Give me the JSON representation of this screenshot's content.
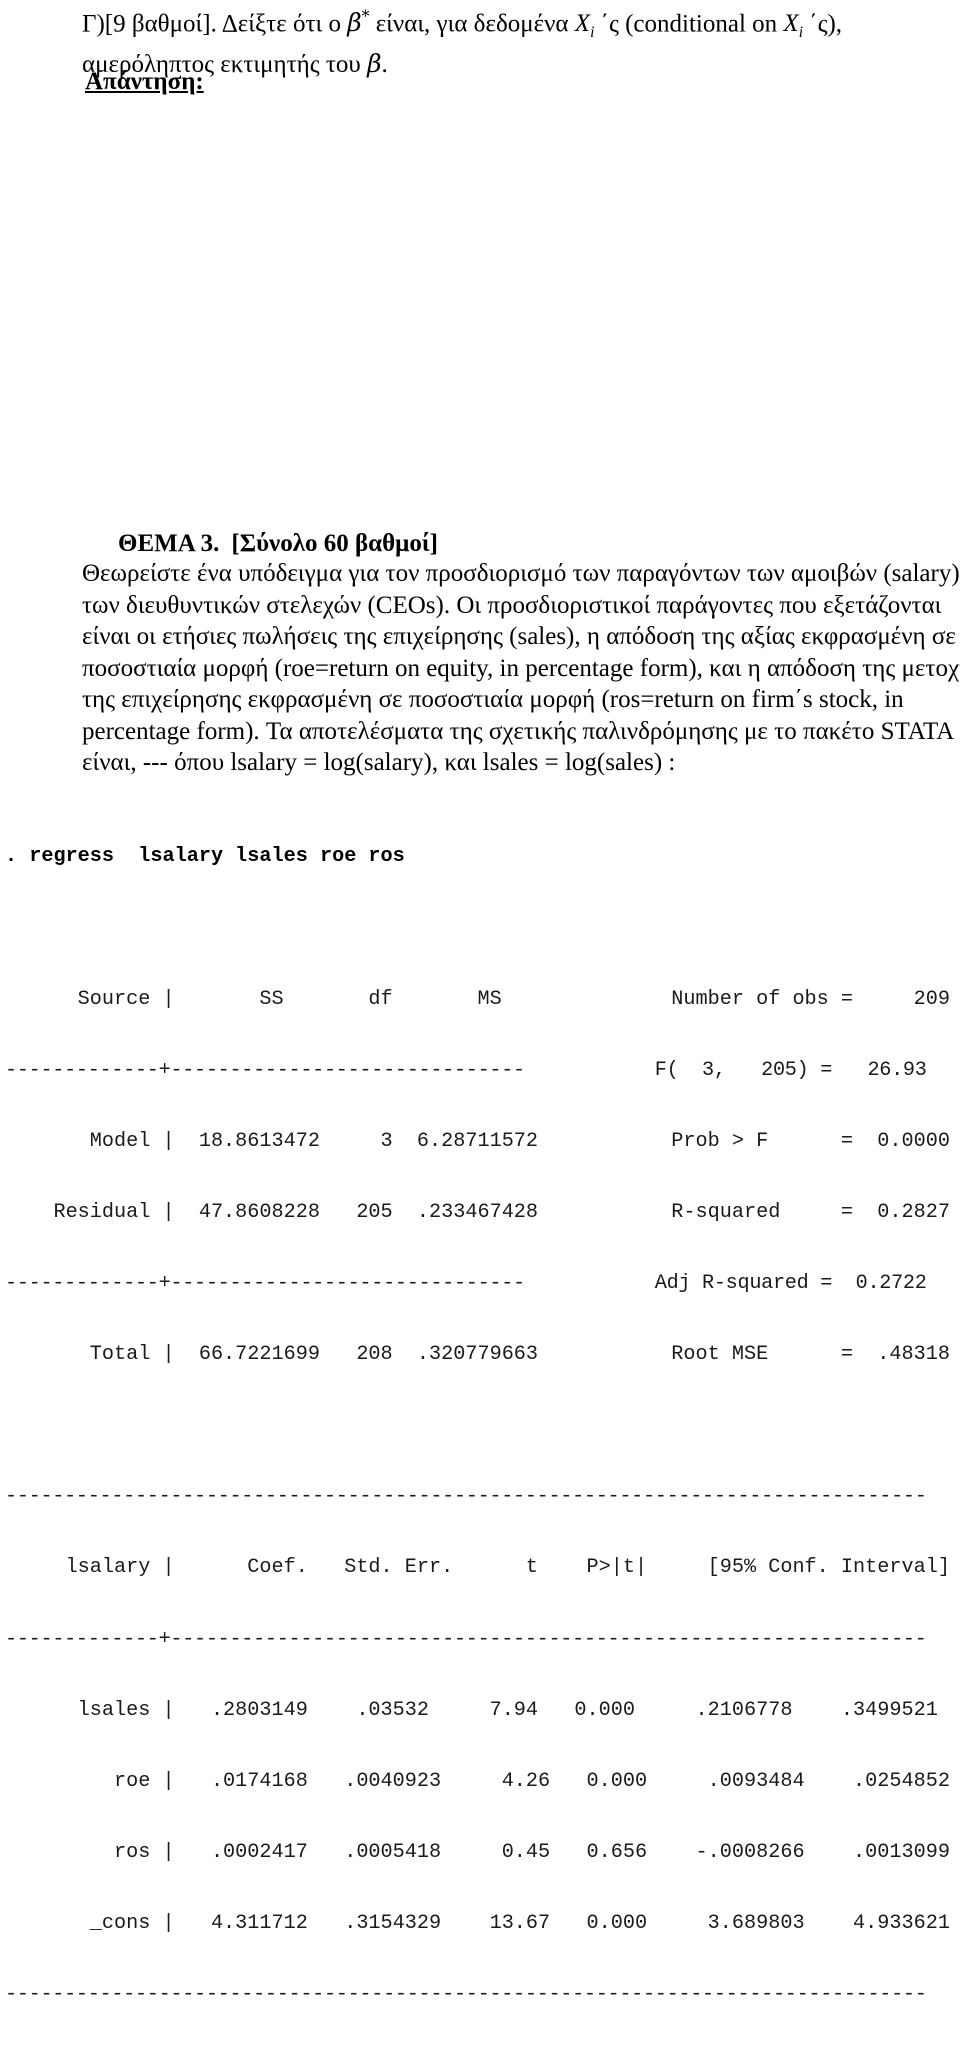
{
  "question_gamma": {
    "line1_pre": "Γ)[9 βαθμοί].  Δείξτε ότι ο ",
    "beta_star_base": "β",
    "beta_star_sup": "*",
    "line1_mid": " είναι, για δεδομένα ",
    "x_var": "X",
    "x_sub": "i",
    "line1_tail": " ΄ς (conditional on ",
    "line1_end": " ΄ς),",
    "line2_pre": "αμερόληπτος εκτιμητής του ",
    "line2_beta": "β",
    "line2_end": ".",
    "answer_label": "Απάντηση:"
  },
  "thema": {
    "number": "ΘΕΜΑ 3.",
    "points": "[Σύνολο 60 βαθμοί]",
    "paragraph_lines": [
      "Θεωρείστε ένα υπόδειγμα για τον προσδιορισμό των παραγόντων των αμοιβών (salary)",
      "των διευθυντικών στελεχών (CEOs).   Οι προσδιοριστικοί παράγοντες που εξετάζονται",
      "είναι οι ετήσιες πωλήσεις της επιχείρησης (sales), η απόδοση της αξίας εκφρασμένη σε",
      "ποσοστιαία μορφή (roe=return on equity, in percentage form), και η απόδοση της μετοχής",
      "της επιχείρησης εκφρασμένη σε ποσοστιαία μορφή (ros=return on firm΄s stock, in",
      "percentage form).   Τα αποτελέσματα της σχετικής παλινδρόμησης με το πακέτο STATA",
      "είναι, --- όπου lsalary = log(salary), και lsales = log(sales) :"
    ]
  },
  "stata": {
    "command": ". regress  lsalary lsales roe ros",
    "anova": {
      "header": "      Source |       SS       df       MS              Number of obs =     209",
      "rule_top": "-------------+------------------------------           F(  3,   205) =   26.93",
      "model": "       Model |  18.8613472     3  6.28711572           Prob > F      =  0.0000",
      "residual": "    Residual |  47.8608228   205  .233467428           R-squared     =  0.2827",
      "rule_mid": "-------------+------------------------------           Adj R-squared =  0.2722",
      "total": "       Total |  66.7221699   208  .320779663           Root MSE      =  .48318"
    },
    "coef_table": {
      "rule_full_top": "------------------------------------------------------------------------------",
      "header": "     lsalary |      Coef.   Std. Err.      t    P>|t|     [95% Conf. Interval]",
      "rule_split": "-------------+----------------------------------------------------------------",
      "rows": [
        "      lsales |   .2803149    .03532     7.94   0.000     .2106778    .3499521",
        "         roe |   .0174168   .0040923     4.26   0.000     .0093484    .0254852",
        "         ros |   .0002417   .0005418     0.45   0.656    -.0008266    .0013099",
        "       _cons |   4.311712   .3154329    13.67   0.000     3.689803    4.933621"
      ],
      "rule_full_bottom": "------------------------------------------------------------------------------"
    },
    "summary_stats": {
      "number_of_obs": "209",
      "f_df1": "3",
      "f_df2": "205",
      "f_value": "26.93",
      "prob_f": "0.0000",
      "r_squared": "0.2827",
      "adj_r_squared": "0.2722",
      "root_mse": ".48318"
    },
    "anova_values": {
      "model_ss": "18.8613472",
      "model_df": "3",
      "model_ms": "6.28711572",
      "residual_ss": "47.8608228",
      "residual_df": "205",
      "residual_ms": ".233467428",
      "total_ss": "66.7221699",
      "total_df": "208",
      "total_ms": ".320779663"
    },
    "coefficients": [
      {
        "name": "lsales",
        "coef": ".2803149",
        "std_err": ".03532",
        "t": "7.94",
        "p": "0.000",
        "ci_low": ".2106778",
        "ci_high": ".3499521"
      },
      {
        "name": "roe",
        "coef": ".0174168",
        "std_err": ".0040923",
        "t": "4.26",
        "p": "0.000",
        "ci_low": ".0093484",
        "ci_high": ".0254852"
      },
      {
        "name": "ros",
        "coef": ".0002417",
        "std_err": ".0005418",
        "t": "0.45",
        "p": "0.656",
        "ci_low": "-.0008266",
        "ci_high": ".0013099"
      },
      {
        "name": "_cons",
        "coef": "4.311712",
        "std_err": ".3154329",
        "t": "13.67",
        "p": "0.000",
        "ci_low": "3.689803",
        "ci_high": "4.933621"
      }
    ]
  }
}
